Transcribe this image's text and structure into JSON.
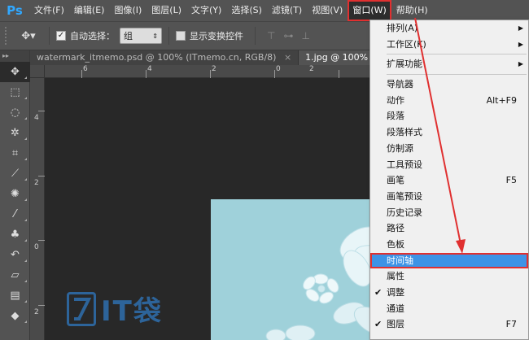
{
  "app": {
    "logo": "Ps"
  },
  "menubar": {
    "items": [
      "文件(F)",
      "编辑(E)",
      "图像(I)",
      "图层(L)",
      "文字(Y)",
      "选择(S)",
      "滤镜(T)",
      "视图(V)",
      "窗口(W)",
      "帮助(H)"
    ],
    "active_index": 8
  },
  "options": {
    "auto_select_label": "自动选择：",
    "auto_select_checked": true,
    "group_value": "组",
    "show_transform_label": "显示变换控件",
    "show_transform_checked": false
  },
  "tabs": [
    {
      "label": "watermark_itmemo.psd @ 100% (ITmemo.cn, RGB/8)",
      "active": false
    },
    {
      "label": "1.jpg @ 100% (ITmem",
      "active": true
    }
  ],
  "rulers": {
    "horizontal": [
      "6",
      "4",
      "2",
      "0",
      "2",
      "4",
      "6"
    ],
    "vertical": [
      "4",
      "2",
      "0",
      "2",
      "4"
    ]
  },
  "watermark": {
    "text": "IT袋"
  },
  "window_menu": {
    "items": [
      {
        "label": "排列(A)",
        "submenu": true
      },
      {
        "label": "工作区(K)",
        "submenu": true
      },
      {
        "separator": true
      },
      {
        "label": "扩展功能",
        "submenu": true
      },
      {
        "separator": true
      },
      {
        "label": "导航器"
      },
      {
        "label": "动作",
        "shortcut": "Alt+F9"
      },
      {
        "label": "段落"
      },
      {
        "label": "段落样式"
      },
      {
        "label": "仿制源"
      },
      {
        "label": "工具预设"
      },
      {
        "label": "画笔",
        "shortcut": "F5"
      },
      {
        "label": "画笔预设"
      },
      {
        "label": "历史记录"
      },
      {
        "label": "路径"
      },
      {
        "label": "色板"
      },
      {
        "label": "时间轴",
        "highlighted": true
      },
      {
        "label": "属性"
      },
      {
        "label": "调整",
        "checked": true
      },
      {
        "label": "通道"
      },
      {
        "label": "图层",
        "shortcut": "F7",
        "checked": true
      }
    ]
  },
  "colors": {
    "menu_bg": "#535353",
    "highlight": "#3d93e6",
    "annotation": "#e03030",
    "image_bg": "#9fd1da",
    "watermark": "#2f6fae"
  }
}
